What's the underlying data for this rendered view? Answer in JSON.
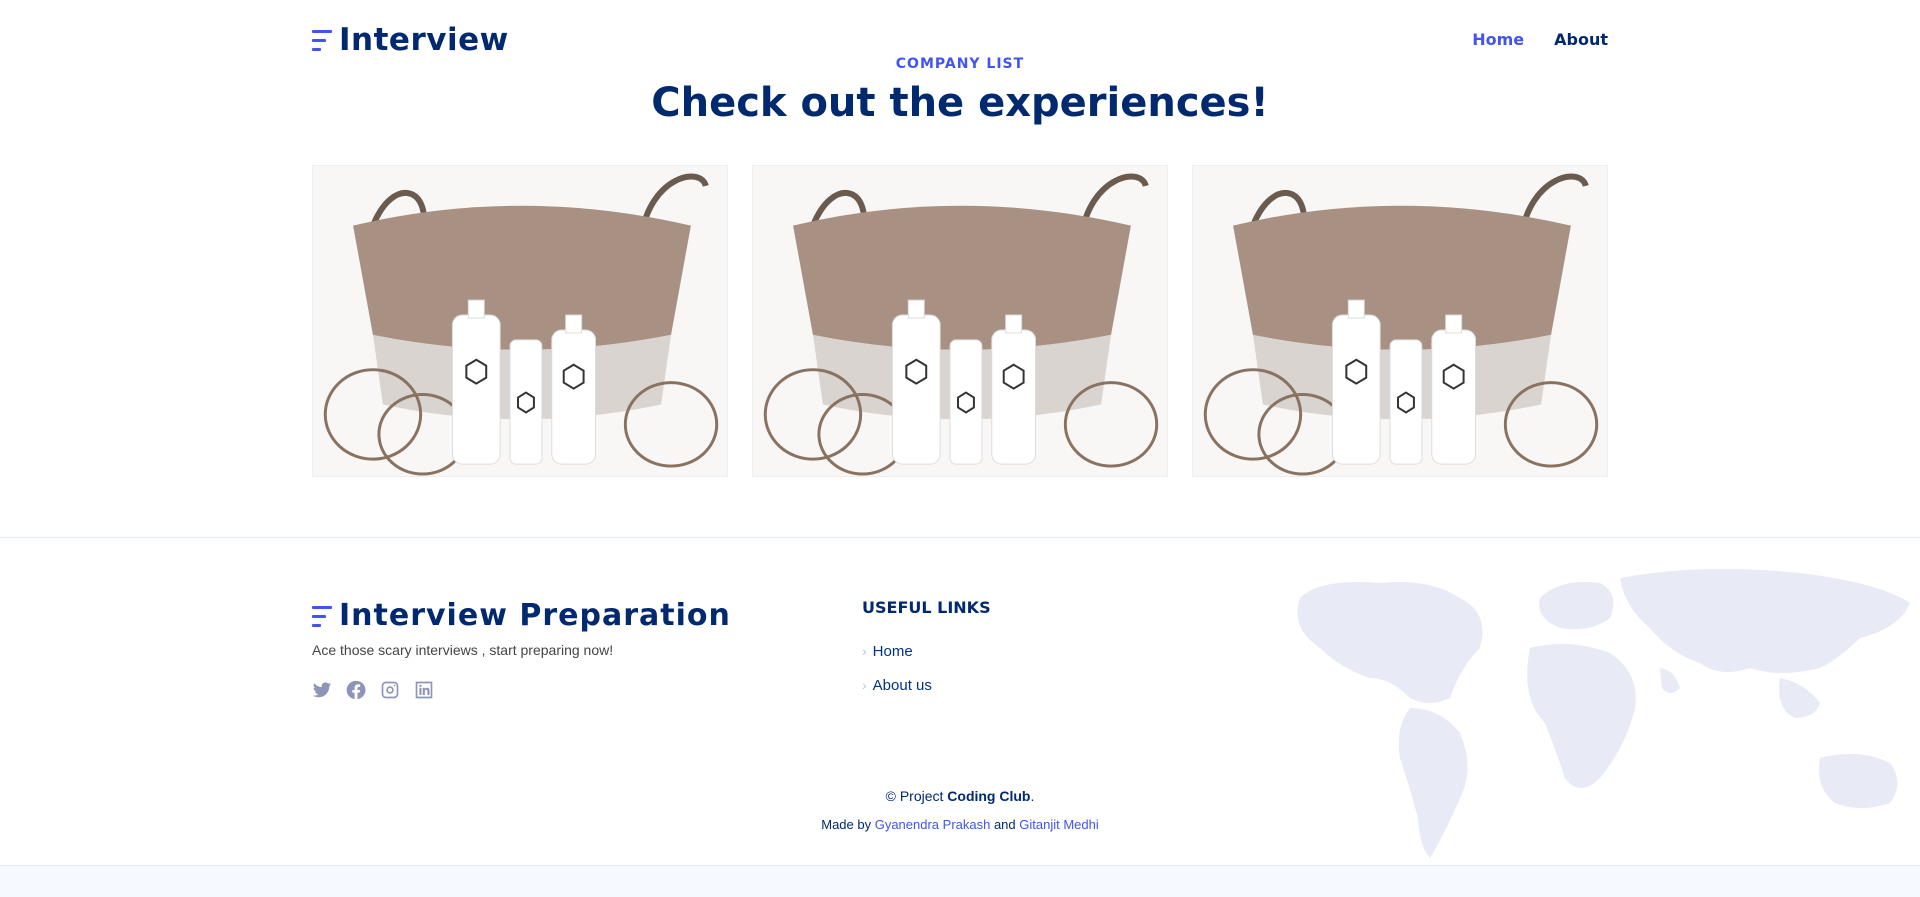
{
  "header": {
    "logo_text": "Interview",
    "nav": [
      {
        "label": "Home",
        "active": true
      },
      {
        "label": "About",
        "active": false
      }
    ]
  },
  "section": {
    "eyebrow": "COMPANY LIST",
    "heading": "Check out the experiences!"
  },
  "cards": [
    {
      "image": "basket-with-bottles"
    },
    {
      "image": "basket-with-bottles"
    },
    {
      "image": "basket-with-bottles"
    }
  ],
  "footer": {
    "logo_text": "Interview Preparation",
    "tagline": "Ace those scary interviews , start preparing now!",
    "socials": [
      "twitter-icon",
      "facebook-icon",
      "instagram-icon",
      "linkedin-icon"
    ],
    "links_title": "USEFUL LINKS",
    "links": [
      {
        "label": "Home"
      },
      {
        "label": "About us"
      }
    ],
    "copyright_prefix": "© Project ",
    "copyright_name": "Coding Club",
    "copyright_suffix": ".",
    "credits_prefix": "Made by ",
    "author1": "Gyanendra Prakash",
    "credits_and": " and ",
    "author2": "Gitanjit Medhi"
  },
  "colors": {
    "primary": "#4154f1",
    "heading": "#012970",
    "map": "#e8eaf5"
  }
}
